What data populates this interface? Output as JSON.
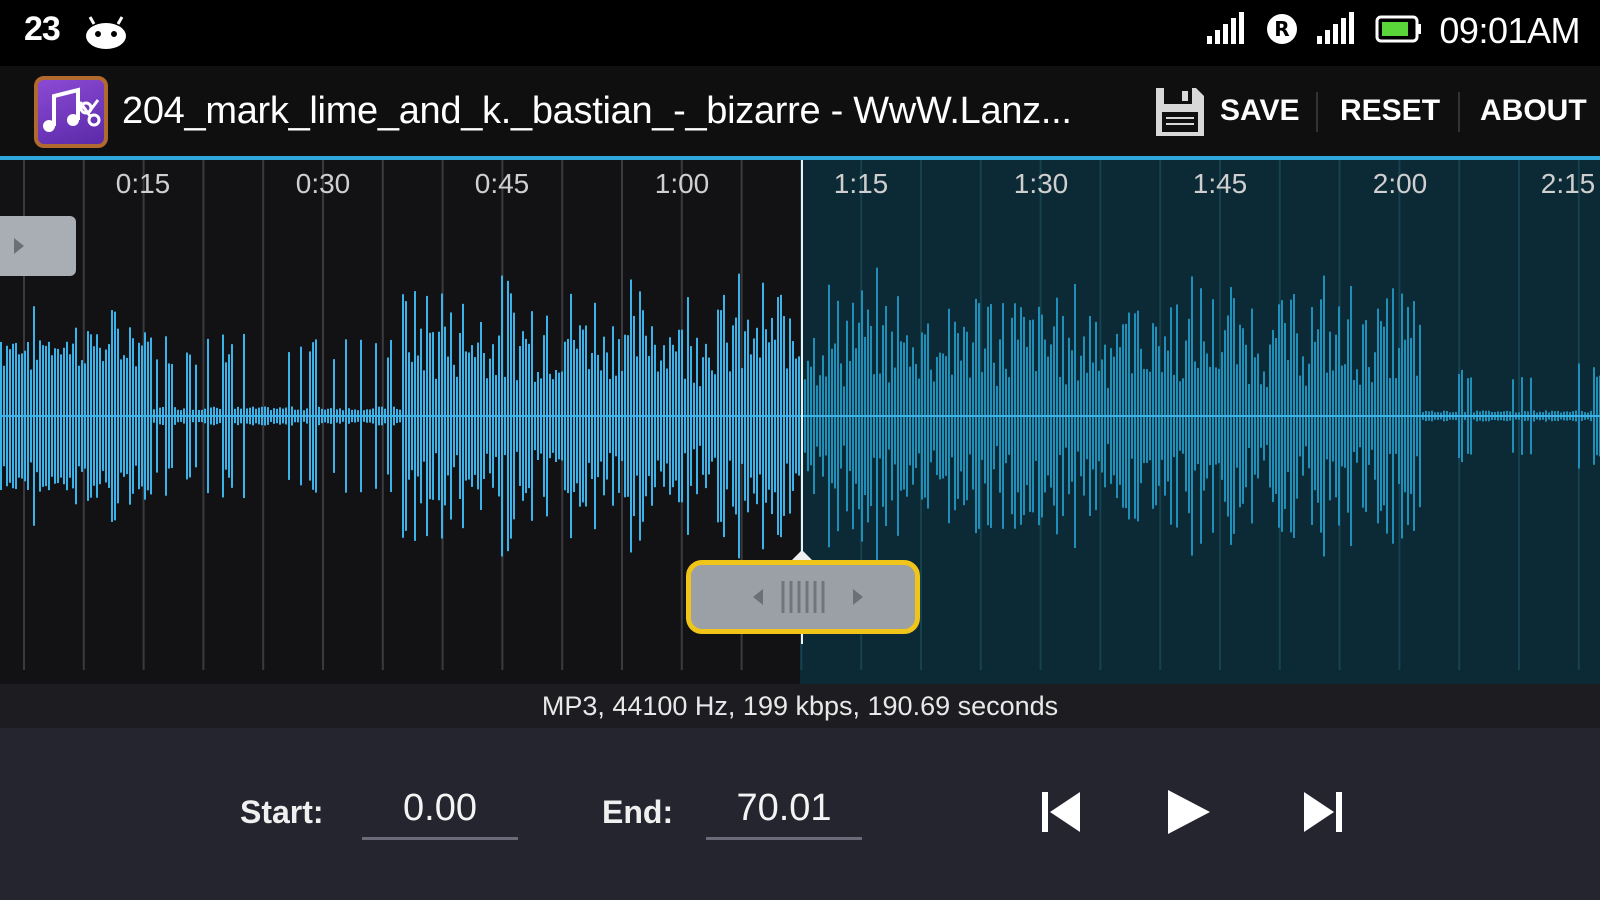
{
  "status_bar": {
    "notification_count": "23",
    "time": "09:01AM",
    "icons": [
      "android-icon",
      "signal-icon",
      "registered-icon",
      "signal-icon",
      "battery-icon"
    ]
  },
  "action_bar": {
    "title": "204_mark_lime_and_k._bastian_-_bizarre - WwW.Lanz...",
    "save_label": "SAVE",
    "reset_label": "RESET",
    "about_label": "ABOUT"
  },
  "waveform": {
    "time_ticks": [
      "0:15",
      "0:30",
      "0:45",
      "1:00",
      "1:15",
      "1:30",
      "1:45",
      "2:00",
      "2:15"
    ],
    "selection_start_seconds": 0.0,
    "selection_end_seconds": 70.01,
    "colors": {
      "selected": "#3bb3e8",
      "unselected": "#1f8fb8",
      "selected_bg": "#121214",
      "unselected_bg": "#0c2a36"
    }
  },
  "file_info": "MP3, 44100 Hz, 199 kbps, 190.69 seconds",
  "controls": {
    "start_label": "Start:",
    "start_value": "0.00",
    "end_label": "End:",
    "end_value": "70.01"
  }
}
